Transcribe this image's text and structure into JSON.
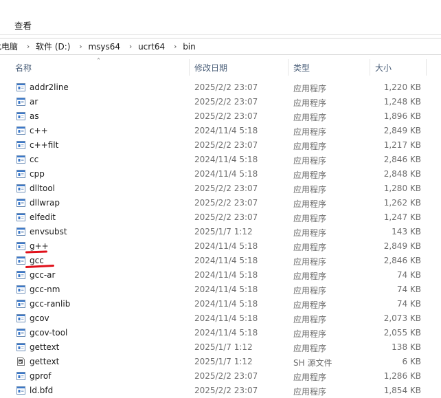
{
  "menu": {
    "view_label": "查看"
  },
  "breadcrumb": {
    "items": [
      "此电脑",
      "软件 (D:)",
      "msys64",
      "ucrt64",
      "bin"
    ]
  },
  "columns": {
    "name": "名称",
    "date": "修改日期",
    "type": "类型",
    "size": "大小"
  },
  "files": [
    {
      "name": "addr2line",
      "date": "2025/2/2 23:07",
      "type": "应用程序",
      "size": "1,220 KB",
      "icon": "exe-icon"
    },
    {
      "name": "ar",
      "date": "2025/2/2 23:07",
      "type": "应用程序",
      "size": "1,248 KB",
      "icon": "exe-icon"
    },
    {
      "name": "as",
      "date": "2025/2/2 23:07",
      "type": "应用程序",
      "size": "1,896 KB",
      "icon": "exe-icon"
    },
    {
      "name": "c++",
      "date": "2024/11/4 5:18",
      "type": "应用程序",
      "size": "2,849 KB",
      "icon": "exe-icon"
    },
    {
      "name": "c++filt",
      "date": "2025/2/2 23:07",
      "type": "应用程序",
      "size": "1,217 KB",
      "icon": "exe-icon"
    },
    {
      "name": "cc",
      "date": "2024/11/4 5:18",
      "type": "应用程序",
      "size": "2,846 KB",
      "icon": "exe-icon"
    },
    {
      "name": "cpp",
      "date": "2024/11/4 5:18",
      "type": "应用程序",
      "size": "2,848 KB",
      "icon": "exe-icon"
    },
    {
      "name": "dlltool",
      "date": "2025/2/2 23:07",
      "type": "应用程序",
      "size": "1,280 KB",
      "icon": "exe-icon"
    },
    {
      "name": "dllwrap",
      "date": "2025/2/2 23:07",
      "type": "应用程序",
      "size": "1,262 KB",
      "icon": "exe-icon"
    },
    {
      "name": "elfedit",
      "date": "2025/2/2 23:07",
      "type": "应用程序",
      "size": "1,247 KB",
      "icon": "exe-icon"
    },
    {
      "name": "envsubst",
      "date": "2025/1/7 1:12",
      "type": "应用程序",
      "size": "143 KB",
      "icon": "exe-icon"
    },
    {
      "name": "g++",
      "date": "2024/11/4 5:18",
      "type": "应用程序",
      "size": "2,849 KB",
      "icon": "exe-icon"
    },
    {
      "name": "gcc",
      "date": "2024/11/4 5:18",
      "type": "应用程序",
      "size": "2,846 KB",
      "icon": "exe-icon"
    },
    {
      "name": "gcc-ar",
      "date": "2024/11/4 5:18",
      "type": "应用程序",
      "size": "74 KB",
      "icon": "exe-icon"
    },
    {
      "name": "gcc-nm",
      "date": "2024/11/4 5:18",
      "type": "应用程序",
      "size": "74 KB",
      "icon": "exe-icon"
    },
    {
      "name": "gcc-ranlib",
      "date": "2024/11/4 5:18",
      "type": "应用程序",
      "size": "74 KB",
      "icon": "exe-icon"
    },
    {
      "name": "gcov",
      "date": "2024/11/4 5:18",
      "type": "应用程序",
      "size": "2,073 KB",
      "icon": "exe-icon"
    },
    {
      "name": "gcov-tool",
      "date": "2024/11/4 5:18",
      "type": "应用程序",
      "size": "2,055 KB",
      "icon": "exe-icon"
    },
    {
      "name": "gettext",
      "date": "2025/1/7 1:12",
      "type": "应用程序",
      "size": "138 KB",
      "icon": "exe-icon"
    },
    {
      "name": "gettext",
      "date": "2025/1/7 1:12",
      "type": "SH 源文件",
      "size": "6 KB",
      "icon": "script-file-icon"
    },
    {
      "name": "gprof",
      "date": "2025/2/2 23:07",
      "type": "应用程序",
      "size": "1,286 KB",
      "icon": "exe-icon"
    },
    {
      "name": "ld.bfd",
      "date": "2025/2/2 23:07",
      "type": "应用程序",
      "size": "1,854 KB",
      "icon": "exe-icon"
    }
  ],
  "annotations": {
    "underlined_files": [
      "g++",
      "gcc"
    ],
    "underline_color": "#e0101a"
  }
}
